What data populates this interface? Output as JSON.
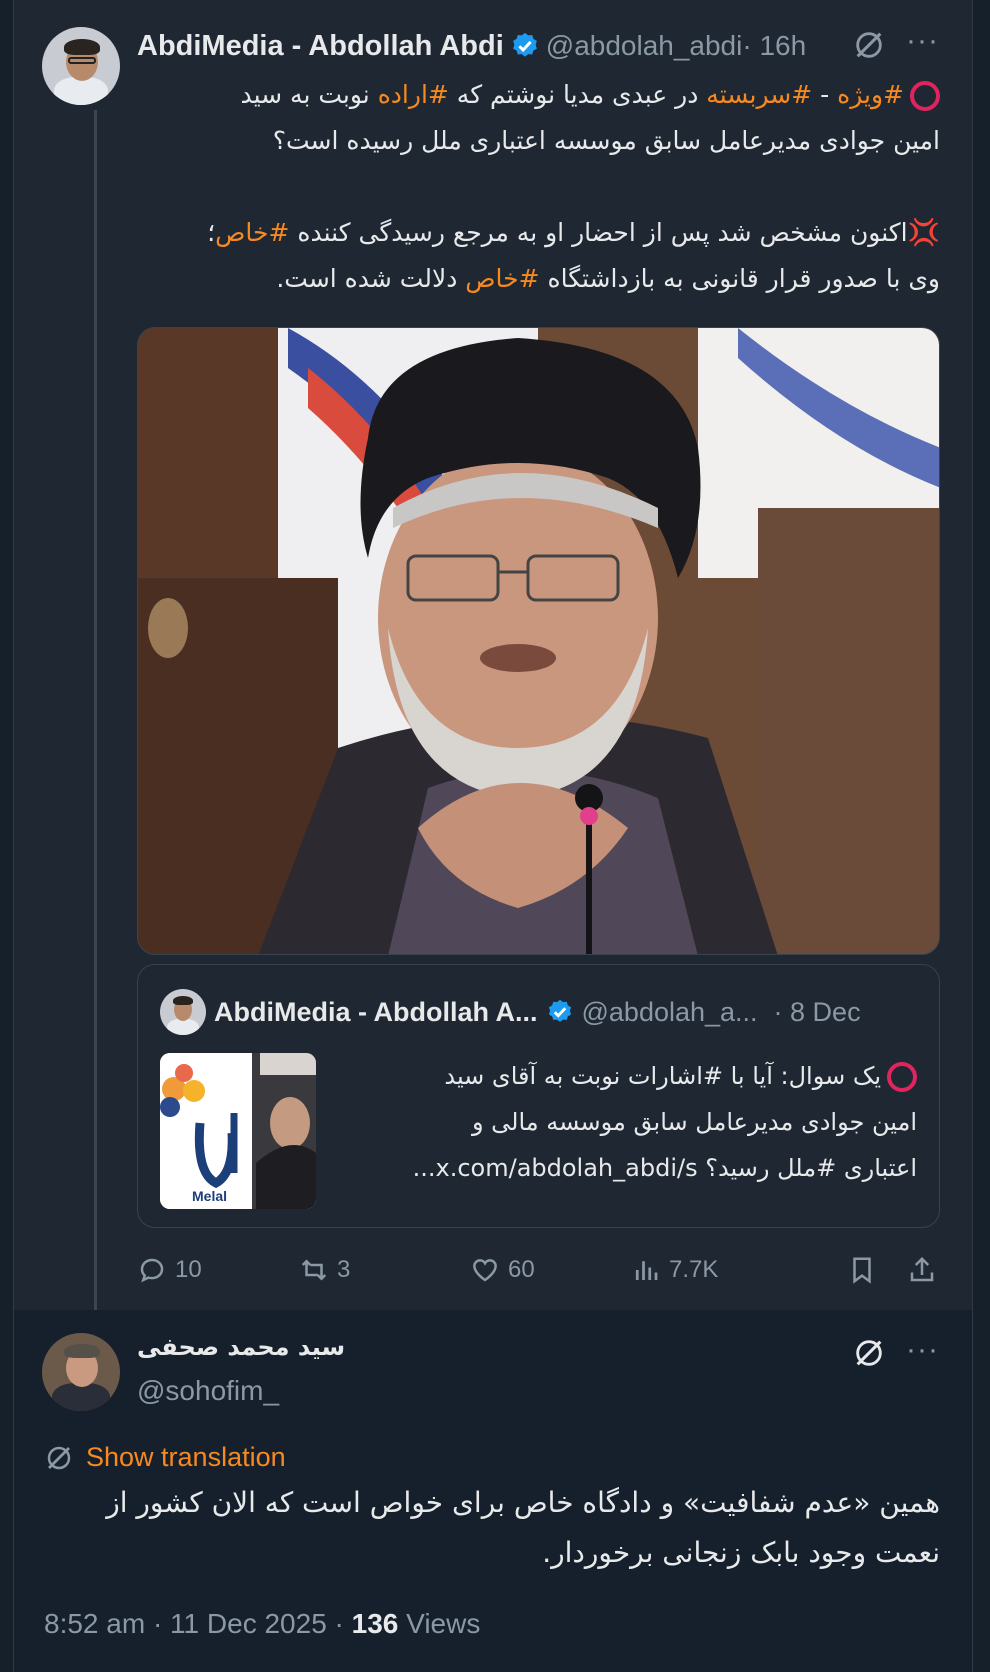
{
  "parent_tweet": {
    "author_name": "AbdiMedia - Abdollah Abdi",
    "handle": "@abdolah_abdi",
    "time_sep": " · 16h",
    "text": {
      "line1_tag1": "#ویژه",
      "line1_dash": " - ",
      "line1_tag2": "#سربسته",
      "line1_mid": " در عبدی مدیا نوشتم که ",
      "line1_tag3": "#اراده",
      "line1_end": " نوبت به سید",
      "line2": "امین جوادی مدیرعامل سابق موسسه اعتباری ملل رسیده است؟",
      "line3_start": "اکنون مشخص شد پس از احضار او به مرجع رسیدگی کننده ",
      "line3_tag": "#خاص",
      "line3_end": "؛",
      "line4_start": "وی با صدور قرار قانونی به بازداشتگاه ",
      "line4_tag": "#خاص",
      "line4_end": " دلالت شده است."
    },
    "quote": {
      "author_name": "AbdiMedia - Abdollah A...",
      "handle": "@abdolah_a...",
      "date": " · 8 Dec",
      "line1": "یک سوال: آیا با #اشارات نوبت به آقای سید",
      "line2": "امین جوادی مدیرعامل سابق موسسه مالی و",
      "line3": "اعتباری #ملل رسید؟ x.com/abdolah_abdi/s...",
      "thumb_brand": "Melal"
    },
    "actions": {
      "replies": "10",
      "retweets": "3",
      "likes": "60",
      "views": "7.7K"
    }
  },
  "reply": {
    "author_name": "سید محمد صحفی",
    "handle": "@sohofim_",
    "show_translation": "Show translation",
    "line1": "همین «عدم شفافیت» و دادگاه خاص برای خواص است که الان کشور از",
    "line2": "نعمت وجود بابک زنجانی برخوردار.",
    "timestamp": "8:52 am · 11 Dec 2025 · ",
    "views_count": "136",
    "views_label": " Views"
  },
  "colors": {
    "background": "#16202c",
    "hashtag": "#f7891f",
    "verified": "#1d9bf0",
    "muted": "#8b98a5"
  }
}
